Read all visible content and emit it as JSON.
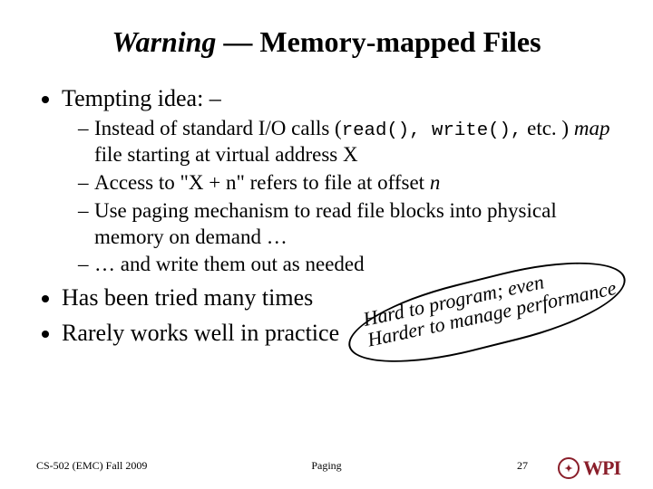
{
  "title": {
    "warning": "Warning",
    "dash": " — ",
    "rest": "Memory-mapped Files"
  },
  "bullets": {
    "tempting": "Tempting idea: –",
    "sub1_a": "Instead of standard I/O calls (",
    "sub1_code": "read(), write(),",
    "sub1_b": " etc. ) ",
    "sub1_map": "map",
    "sub1_c": " file starting at virtual address X",
    "sub2_a": "Access to \"X + n\" refers to file at offset ",
    "sub2_n": "n",
    "sub3": "Use paging mechanism to read file blocks into physical memory on demand …",
    "sub4": "… and write them out as needed",
    "tried": "Has been tried many times",
    "rarely": "Rarely works well in practice"
  },
  "callout": {
    "line1": "Hard to program; even",
    "line2": "Harder to manage performance"
  },
  "footer": {
    "course": "CS-502 (EMC) Fall 2009",
    "topic": "Paging",
    "num": "27",
    "logo_text": "WPI"
  }
}
